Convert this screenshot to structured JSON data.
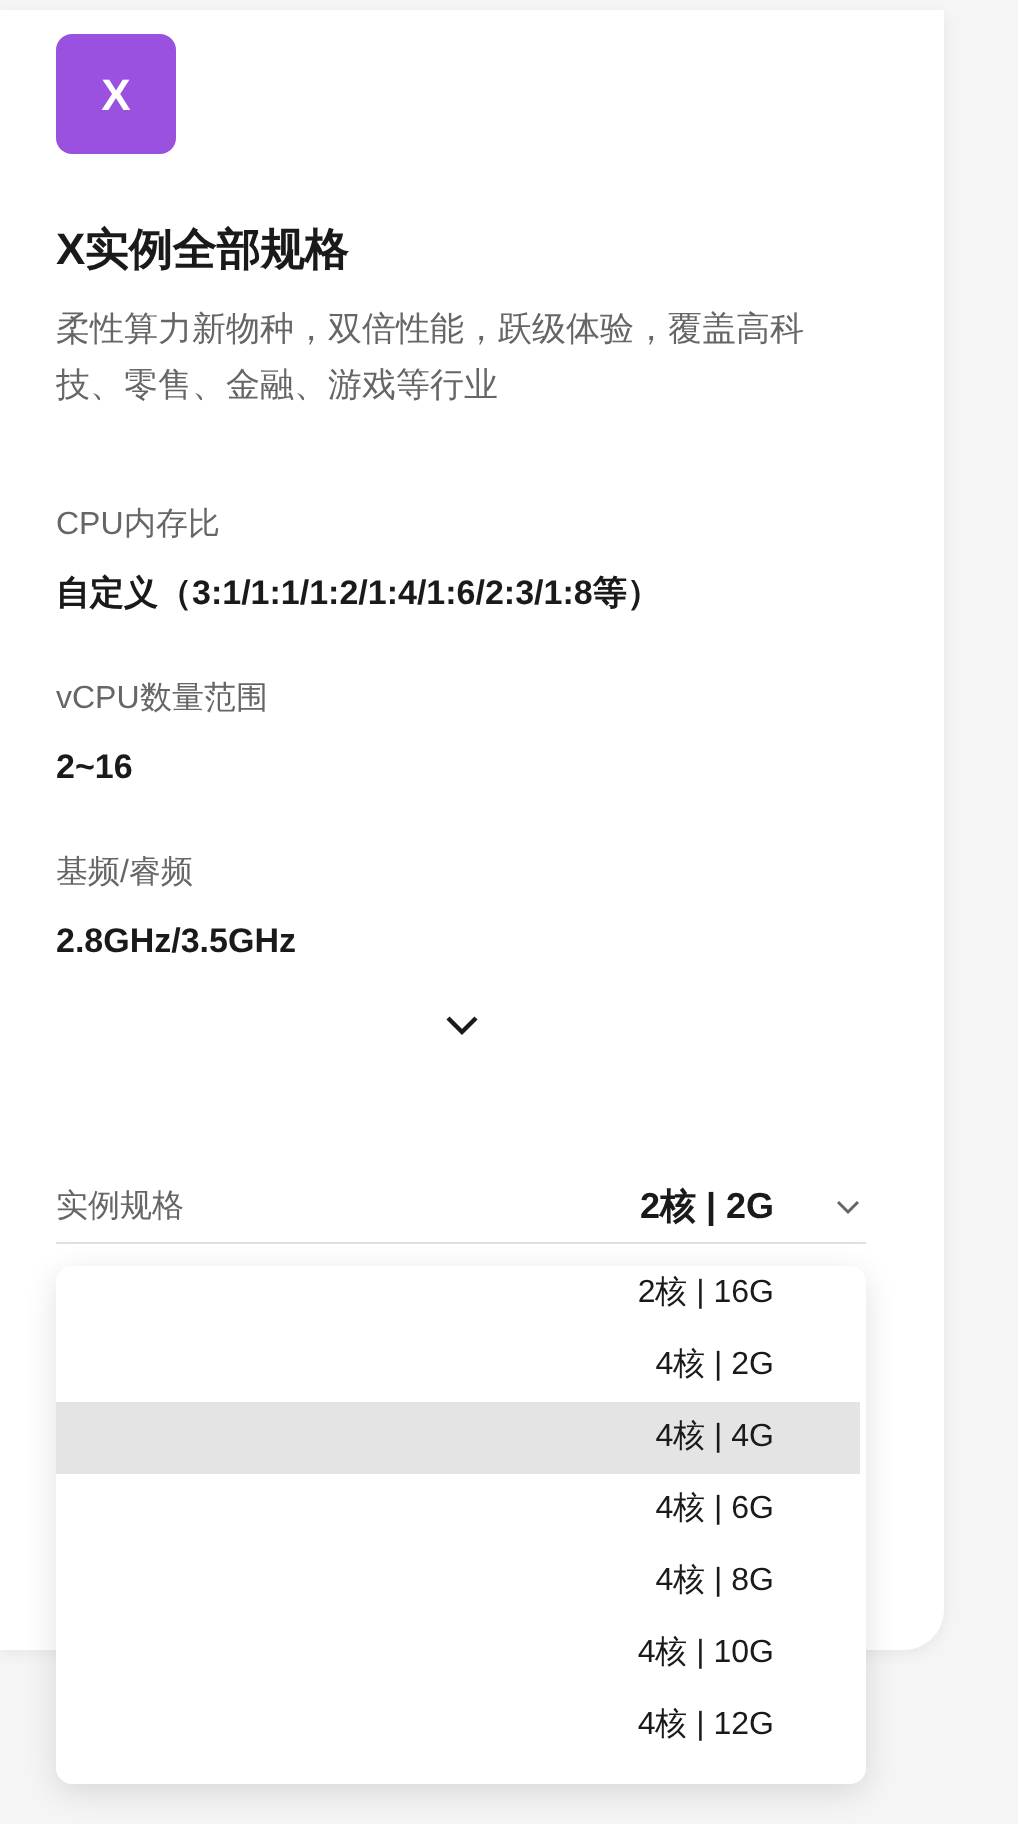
{
  "logo": {
    "letter": "X"
  },
  "title": "X实例全部规格",
  "description": "柔性算力新物种，双倍性能，跃级体验，覆盖高科技、零售、金融、游戏等行业",
  "specs": [
    {
      "label": "CPU内存比",
      "value": "自定义（3:1/1:1/1:2/1:4/1:6/2:3/1:8等）"
    },
    {
      "label": "vCPU数量范围",
      "value": "2~16"
    },
    {
      "label": "基频/睿频",
      "value": "2.8GHz/3.5GHz"
    }
  ],
  "select": {
    "label": "实例规格",
    "value": "2核 | 2G",
    "expanded": true
  },
  "options": [
    {
      "text": "2核 | 16G",
      "selected": false
    },
    {
      "text": "4核 | 2G",
      "selected": false
    },
    {
      "text": "4核 | 4G",
      "selected": true
    },
    {
      "text": "4核 | 6G",
      "selected": false
    },
    {
      "text": "4核 | 8G",
      "selected": false
    },
    {
      "text": "4核 | 10G",
      "selected": false
    },
    {
      "text": "4核 | 12G",
      "selected": false
    }
  ]
}
